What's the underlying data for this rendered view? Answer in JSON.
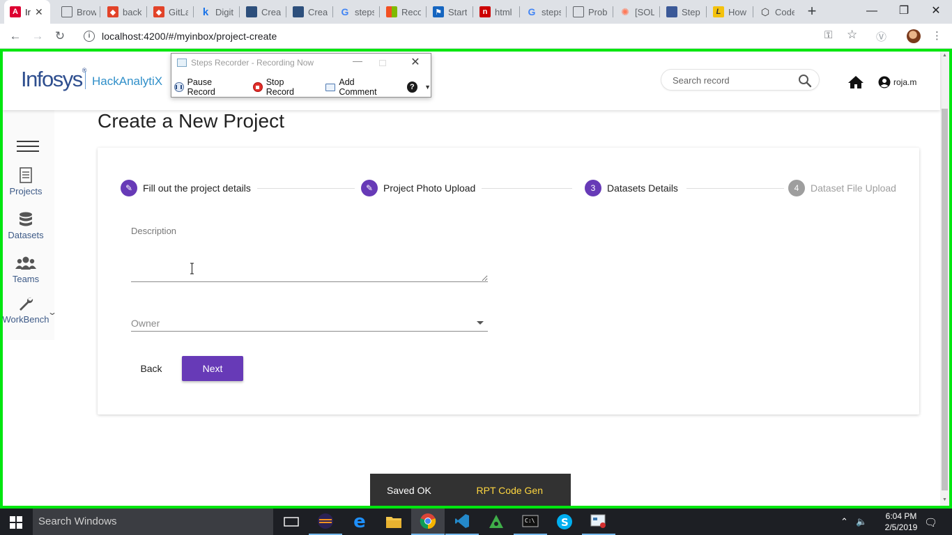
{
  "browser": {
    "tabs": [
      {
        "title": "Ir",
        "icon": "angular-icon",
        "color": "#dd0031",
        "active": true
      },
      {
        "title": "Brow",
        "icon": "document-icon",
        "color": "#ffffff"
      },
      {
        "title": "back",
        "icon": "gitlab-icon",
        "color": "#e24329"
      },
      {
        "title": "GitLa",
        "icon": "gitlab-icon",
        "color": "#e24329"
      },
      {
        "title": "Digit",
        "icon": "k-icon",
        "color": "#1a73e8"
      },
      {
        "title": "Creat",
        "icon": "window-icon",
        "color": "#2d4f7c"
      },
      {
        "title": "Creat",
        "icon": "window-icon",
        "color": "#2d4f7c"
      },
      {
        "title": "steps",
        "icon": "google-icon",
        "color": "#4285f4"
      },
      {
        "title": "Reco",
        "icon": "microsoft-icon",
        "color": "#f25022"
      },
      {
        "title": "Start",
        "icon": "flag-icon",
        "color": "#1565c0"
      },
      {
        "title": "html",
        "icon": "n-icon",
        "color": "#cc0000"
      },
      {
        "title": "steps",
        "icon": "google-icon",
        "color": "#4285f4"
      },
      {
        "title": "Prob",
        "icon": "document-icon",
        "color": "#ffffff"
      },
      {
        "title": "[SOL",
        "icon": "hubspot-icon",
        "color": "#ff7a59"
      },
      {
        "title": "Step",
        "icon": "steps-icon",
        "color": "#3b5998"
      },
      {
        "title": "How",
        "icon": "l-icon",
        "color": "#f4c20d"
      },
      {
        "title": "Code",
        "icon": "codepen-icon",
        "color": "#333333"
      }
    ],
    "url": "localhost:4200/#/myinbox/project-create"
  },
  "recorder": {
    "title": "Steps Recorder - Recording Now",
    "pause_label": "Pause Record",
    "stop_label": "Stop Record",
    "comment_label": "Add Comment",
    "help_label": "?"
  },
  "header": {
    "logo_text": "Infosys",
    "logo_mark": "®",
    "product_name": "HackAnalytiX",
    "search_placeholder": "Search record",
    "user_name": "roja.m"
  },
  "sidenav": {
    "items": [
      {
        "label": "Projects",
        "icon": "projects-icon"
      },
      {
        "label": "Datasets",
        "icon": "database-icon"
      },
      {
        "label": "Teams",
        "icon": "users-icon"
      },
      {
        "label": "WorkBench",
        "icon": "wrench-icon"
      }
    ]
  },
  "page": {
    "title": "Create a New Project",
    "steps": [
      {
        "marker": "✎",
        "label": "Fill out the project details",
        "state": "done"
      },
      {
        "marker": "✎",
        "label": "Project Photo Upload",
        "state": "done"
      },
      {
        "marker": "3",
        "label": "Datasets Details",
        "state": "active"
      },
      {
        "marker": "4",
        "label": "Dataset File Upload",
        "state": "todo"
      }
    ],
    "description_label": "Description",
    "description_value": "",
    "owner_placeholder": "Owner",
    "back_label": "Back",
    "next_label": "Next",
    "accent_color": "#673ab7"
  },
  "snackbar": {
    "message": "Saved OK",
    "action": "RPT Code Gen"
  },
  "taskbar": {
    "search_placeholder": "Search Windows",
    "time": "6:04 PM",
    "date": "2/5/2019"
  }
}
